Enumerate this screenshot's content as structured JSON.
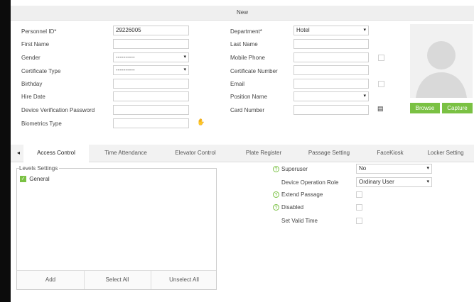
{
  "window": {
    "title": "New"
  },
  "left_fields": [
    {
      "label": "Personnel ID*",
      "value": "29226005",
      "type": "input"
    },
    {
      "label": "First Name",
      "value": "",
      "type": "input"
    },
    {
      "label": "Gender",
      "value": "----------",
      "type": "select"
    },
    {
      "label": "Certificate Type",
      "value": "----------",
      "type": "select"
    },
    {
      "label": "Birthday",
      "value": "",
      "type": "input"
    },
    {
      "label": "Hire Date",
      "value": "",
      "type": "input"
    },
    {
      "label": "Device Verification Password",
      "value": "",
      "type": "input"
    },
    {
      "label": "Biometrics Type",
      "value": "",
      "type": "input"
    }
  ],
  "right_fields": [
    {
      "label": "Department*",
      "value": "Hotel",
      "type": "select"
    },
    {
      "label": "Last Name",
      "value": "",
      "type": "input"
    },
    {
      "label": "Mobile Phone",
      "value": "",
      "type": "input"
    },
    {
      "label": "Certificate Number",
      "value": "",
      "type": "input"
    },
    {
      "label": "Email",
      "value": "",
      "type": "input"
    },
    {
      "label": "Position Name",
      "value": "",
      "type": "select"
    },
    {
      "label": "Card Number",
      "value": "",
      "type": "input"
    }
  ],
  "photo": {
    "browse_label": "Browse",
    "capture_label": "Capture"
  },
  "tabs": [
    "Access Control",
    "Time Attendance",
    "Elevator Control",
    "Plate Register",
    "Passage Setting",
    "FaceKiosk",
    "Locker Setting"
  ],
  "active_tab": "Access Control",
  "levels": {
    "title": "Levels Settings",
    "items": [
      {
        "label": "General",
        "checked": true
      }
    ],
    "add_label": "Add",
    "select_all_label": "Select All",
    "unselect_all_label": "Unselect All"
  },
  "access": {
    "superuser_label": "Superuser",
    "superuser_value": "No",
    "role_label": "Device Operation Role",
    "role_value": "Ordinary User",
    "extend_label": "Extend Passage",
    "disabled_label": "Disabled",
    "valid_time_label": "Set Valid Time"
  },
  "colors": {
    "accent": "#7ac143",
    "tab_bar": "#f2f2f2"
  }
}
